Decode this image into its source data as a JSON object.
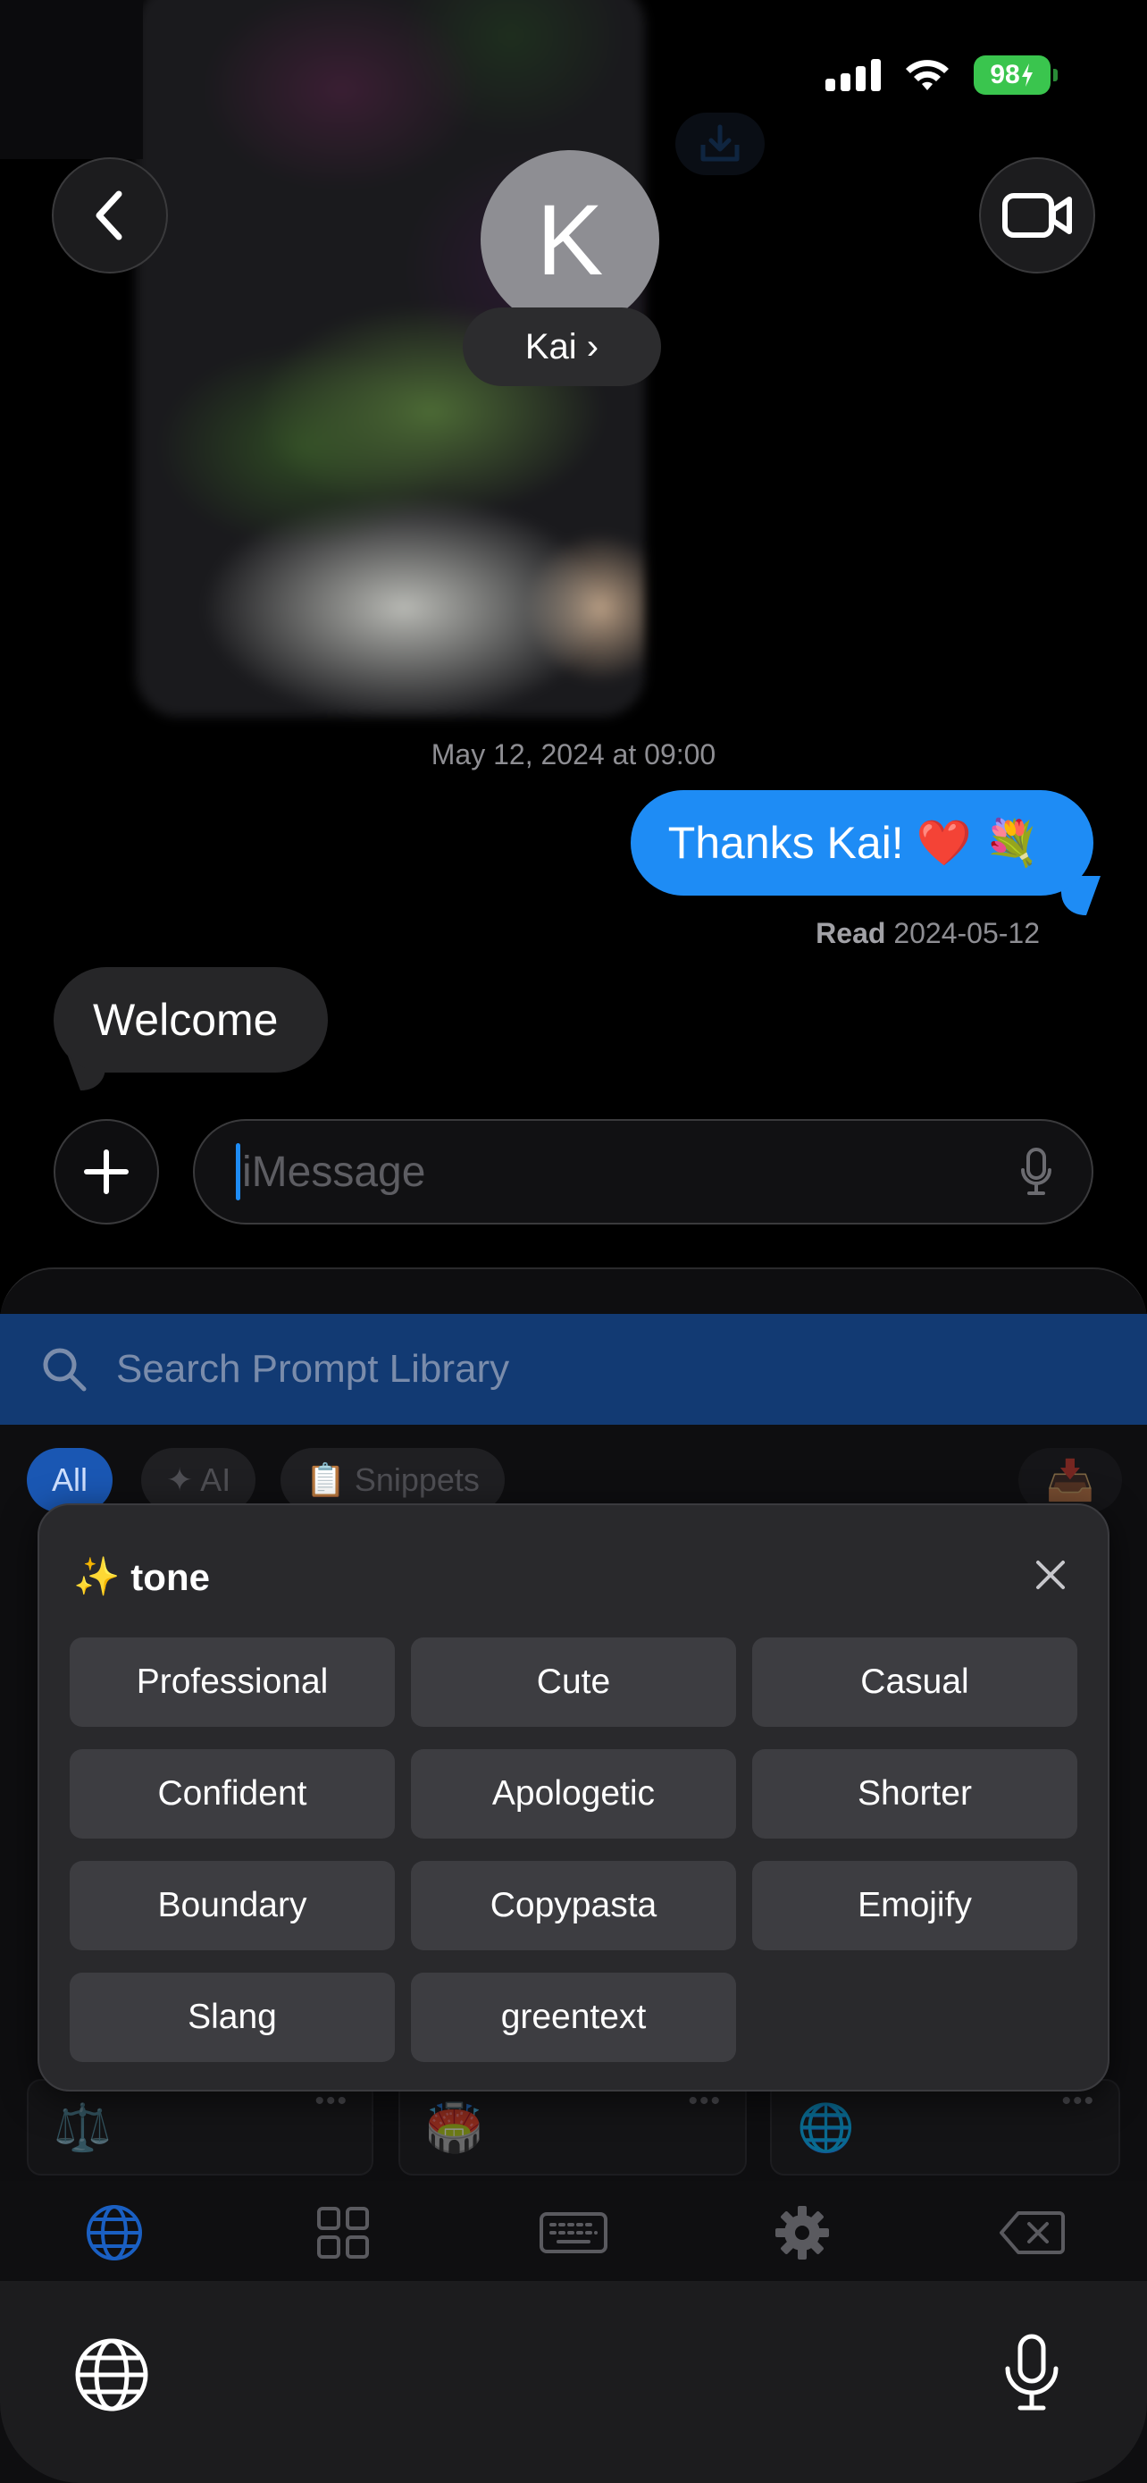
{
  "status_bar": {
    "battery": "98"
  },
  "conversation": {
    "contact_initial": "K",
    "contact_name": "Kai ›",
    "timestamp": "May 12, 2024 at 09:00",
    "outgoing_message": "Thanks Kai! ❤️ 💐",
    "read_label": "Read",
    "read_date": "2024-05-12",
    "incoming_message": "Welcome",
    "input_placeholder": "iMessage"
  },
  "keyboard": {
    "search_placeholder": "Search Prompt Library",
    "filters": [
      {
        "label": "All"
      },
      {
        "label": "✦ AI"
      },
      {
        "label": "📋 Snippets"
      }
    ],
    "inbox_icon": "📥",
    "cards": [
      {
        "emoji": "⚖️",
        "menu": "•••"
      },
      {
        "emoji": "🏟️",
        "menu": "•••"
      },
      {
        "emoji": "🌐",
        "menu": "•••"
      }
    ],
    "toolbar_icons": [
      "globe-icon",
      "grid-icon",
      "keyboard-icon",
      "gear-icon",
      "delete-icon"
    ],
    "accent_color": "#1e8cf5"
  },
  "tone_popup": {
    "icon": "✨",
    "title": "tone",
    "options": [
      "Professional",
      "Cute",
      "Casual",
      "Confident",
      "Apologetic",
      "Shorter",
      "Boundary",
      "Copypasta",
      "Emojify",
      "Slang",
      "greentext"
    ]
  }
}
